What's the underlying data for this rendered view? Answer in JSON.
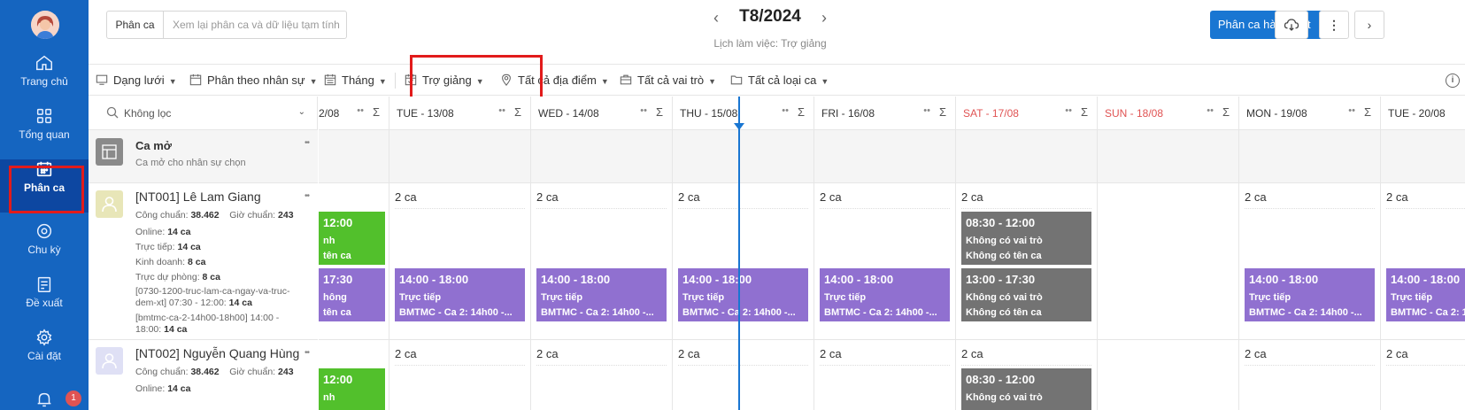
{
  "sidebar": {
    "items": [
      {
        "label": "Trang chủ",
        "icon": "home-icon"
      },
      {
        "label": "Tổng quan",
        "icon": "grid-icon"
      },
      {
        "label": "Phân ca",
        "icon": "calendar-icon",
        "active": true
      },
      {
        "label": "Chu kỳ",
        "icon": "cycle-icon"
      },
      {
        "label": "Đề xuất",
        "icon": "proposal-icon"
      },
      {
        "label": "Cài đặt",
        "icon": "gear-icon"
      }
    ],
    "notification_count": "1"
  },
  "header": {
    "search_label": "Phân ca",
    "search_placeholder": "Xem lại phân ca và dữ liệu tạm tính",
    "month": "T8/2024",
    "subtitle": "Lịch làm việc: Trợ giảng",
    "bulk_button": "Phân ca hàng loạt"
  },
  "toolbar": {
    "items": [
      {
        "label": "Dạng lưới",
        "icon": "monitor-icon"
      },
      {
        "label": "Phân theo nhân sự",
        "icon": "calendar-people-icon"
      },
      {
        "label": "Tháng",
        "icon": "calendar-month-icon"
      },
      {
        "label": "Trợ giảng",
        "icon": "calendar-check-icon"
      },
      {
        "label": "Tất cả địa điểm",
        "icon": "location-icon"
      },
      {
        "label": "Tất cả vai trò",
        "icon": "briefcase-icon"
      },
      {
        "label": "Tất cả loại ca",
        "icon": "folder-icon"
      }
    ]
  },
  "filter": {
    "label": "Không lọc"
  },
  "open_shift": {
    "title": "Ca mở",
    "subtitle": "Ca mở cho nhân sự chọn"
  },
  "employees": [
    {
      "name": "[NT001] Lê Lam Giang",
      "cong_chuan_label": "Công chuẩn:",
      "cong_chuan": "38.462",
      "gio_chuan_label": "Giờ chuẩn:",
      "gio_chuan": "243",
      "stats": [
        {
          "label": "Online:",
          "value": "14 ca"
        },
        {
          "label": "Trực tiếp:",
          "value": "14 ca"
        },
        {
          "label": "Kinh doanh:",
          "value": "8 ca"
        },
        {
          "label": "Trực dự phòng:",
          "value": "8 ca"
        },
        {
          "label": "[0730-1200-truc-lam-ca-ngay-va-truc-dem-xt] 07:30 - 12:00:",
          "value": "14 ca"
        },
        {
          "label": "[bmtmc-ca-2-14h00-18h00] 14:00 - 18:00:",
          "value": "14 ca"
        }
      ]
    },
    {
      "name": "[NT002] Nguyễn Quang Hùng",
      "cong_chuan_label": "Công chuẩn:",
      "cong_chuan": "38.462",
      "gio_chuan_label": "Giờ chuẩn:",
      "gio_chuan": "243",
      "stats": [
        {
          "label": "Online:",
          "value": "14 ca"
        }
      ]
    }
  ],
  "days": [
    {
      "label": "2/08",
      "weekend": false
    },
    {
      "label": "TUE - 13/08",
      "weekend": false
    },
    {
      "label": "WED - 14/08",
      "weekend": false
    },
    {
      "label": "THU - 15/08",
      "weekend": false
    },
    {
      "label": "FRI - 16/08",
      "weekend": false
    },
    {
      "label": "SAT - 17/08",
      "weekend": true
    },
    {
      "label": "SUN - 18/08",
      "weekend": true
    },
    {
      "label": "MON - 19/08",
      "weekend": false
    },
    {
      "label": "TUE - 20/08",
      "weekend": false
    }
  ],
  "shift_count": "2 ca",
  "shifts": {
    "green_partial": {
      "time": "12:00",
      "role": "nh",
      "name": "tên ca"
    },
    "purple_partial": {
      "time": "17:30",
      "role": "hông",
      "name": "tên ca"
    },
    "purple": {
      "time": "14:00 - 18:00",
      "role": "Trực tiếp",
      "name": "BMTMC - Ca 2: 14h00 -..."
    },
    "gray_morning": {
      "time": "08:30 - 12:00",
      "role": "Không có vai trò",
      "name": "Không có tên ca"
    },
    "gray_afternoon": {
      "time": "13:00 - 17:30",
      "role": "Không có vai trò",
      "name": "Không có tên ca"
    }
  },
  "colors": {
    "sidebar": "#1565c0",
    "primary": "#1976d2",
    "shift_green": "#52c02c",
    "shift_purple": "#9070d0",
    "shift_gray": "#737373",
    "weekend": "#e05353",
    "highlight": "#e21b1b"
  }
}
